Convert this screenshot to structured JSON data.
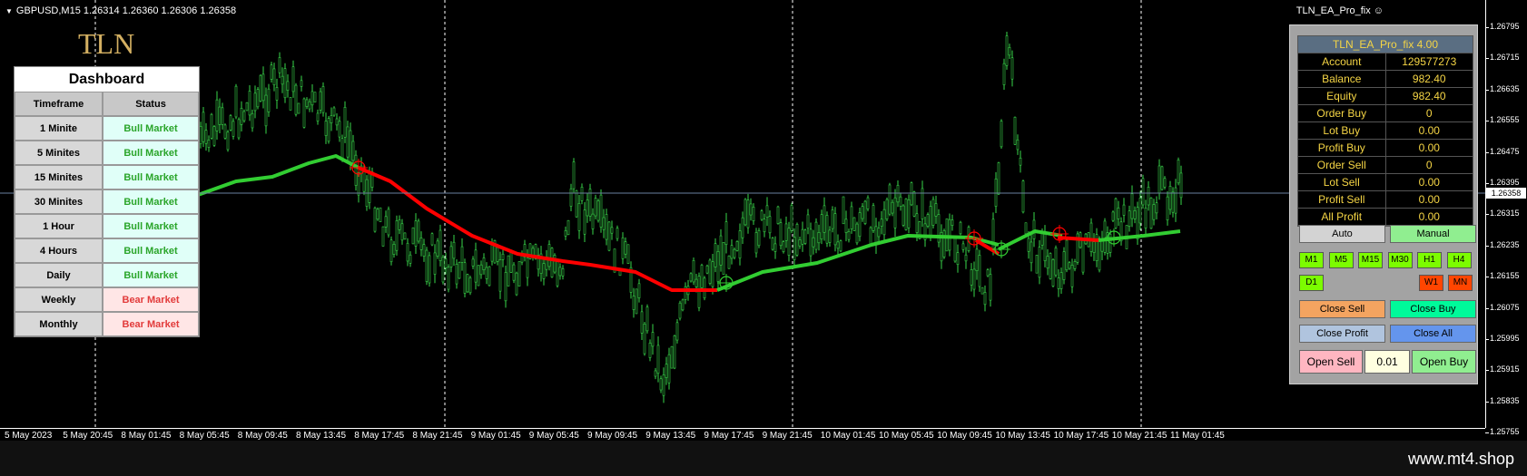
{
  "chart": {
    "symbol_info": "GBPUSD,M15  1.26314 1.26360 1.26306 1.26358",
    "ea_name": "TLN_EA_Pro_fix",
    "smiley": "☺",
    "logo": "TLN",
    "current_price": "1.26358",
    "price_ticks": [
      "1.26795",
      "1.26715",
      "1.26635",
      "1.26555",
      "1.26475",
      "1.26395",
      "1.26315",
      "1.26235",
      "1.26155",
      "1.26075",
      "1.25995",
      "1.25915",
      "1.25835",
      "1.25755"
    ],
    "time_ticks": [
      "5 May 2023",
      "5 May 20:45",
      "8 May 01:45",
      "8 May 05:45",
      "8 May 09:45",
      "8 May 13:45",
      "8 May 17:45",
      "8 May 21:45",
      "9 May 01:45",
      "9 May 05:45",
      "9 May 09:45",
      "9 May 13:45",
      "9 May 17:45",
      "9 May 21:45",
      "10 May 01:45",
      "10 May 05:45",
      "10 May 09:45",
      "10 May 13:45",
      "10 May 17:45",
      "10 May 21:45",
      "11 May 01:45"
    ],
    "colors": {
      "candles": "#39d64a",
      "ma_up": "#32cd32",
      "ma_down": "#ff0000",
      "grid": "#ffffff"
    }
  },
  "dashboard": {
    "title": "Dashboard",
    "col_timeframe": "Timeframe",
    "col_status": "Status",
    "rows": [
      {
        "tf": "1 Minite",
        "status": "Bull Market",
        "type": "bull"
      },
      {
        "tf": "5 Minites",
        "status": "Bull Market",
        "type": "bull"
      },
      {
        "tf": "15 Minites",
        "status": "Bull Market",
        "type": "bull"
      },
      {
        "tf": "30 Minites",
        "status": "Bull Market",
        "type": "bull"
      },
      {
        "tf": "1 Hour",
        "status": "Bull Market",
        "type": "bull"
      },
      {
        "tf": "4 Hours",
        "status": "Bull Market",
        "type": "bull"
      },
      {
        "tf": "Daily",
        "status": "Bull Market",
        "type": "bull"
      },
      {
        "tf": "Weekly",
        "status": "Bear Market",
        "type": "bear"
      },
      {
        "tf": "Monthly",
        "status": "Bear Market",
        "type": "bear"
      }
    ]
  },
  "ea_panel": {
    "title": "TLN_EA_Pro_fix 4.00",
    "rows": [
      {
        "label": "Account",
        "value": "129577273"
      },
      {
        "label": "Balance",
        "value": "982.40"
      },
      {
        "label": "Equity",
        "value": "982.40"
      },
      {
        "label": "Order Buy",
        "value": "0"
      },
      {
        "label": "Lot Buy",
        "value": "0.00"
      },
      {
        "label": "Profit Buy",
        "value": "0.00"
      },
      {
        "label": "Order Sell",
        "value": "0"
      },
      {
        "label": "Lot Sell",
        "value": "0.00"
      },
      {
        "label": "Profit Sell",
        "value": "0.00"
      },
      {
        "label": "All Profit",
        "value": "0.00"
      }
    ],
    "auto_label": "Auto",
    "manual_label": "Manual",
    "timeframes": [
      "M1",
      "M5",
      "M15",
      "M30",
      "H1",
      "H4"
    ],
    "d1": "D1",
    "w1": "W1",
    "mn": "MN",
    "close_sell": "Close Sell",
    "close_buy": "Close Buy",
    "close_profit": "Close Profit",
    "close_all": "Close All",
    "open_sell": "Open Sell",
    "lot_value": "0.01",
    "open_buy": "Open Buy"
  },
  "footer": {
    "url": "www.mt4.shop"
  }
}
